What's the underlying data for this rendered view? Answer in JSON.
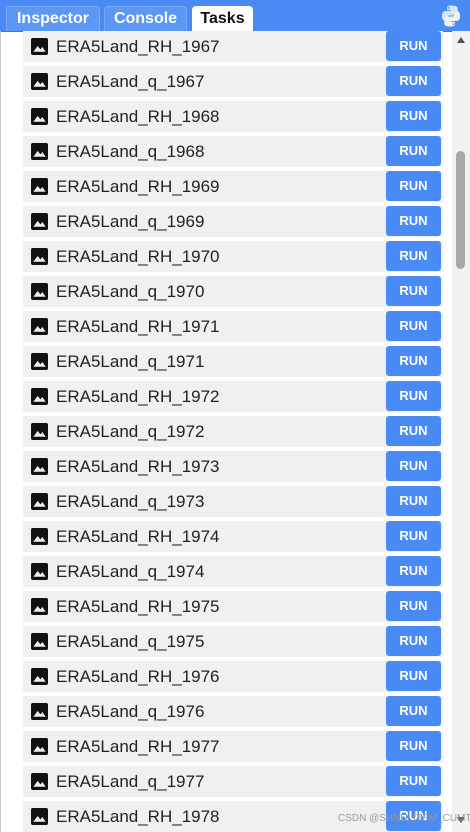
{
  "tabs": {
    "inspector": "Inspector",
    "console": "Console",
    "tasks": "Tasks",
    "active": "Tasks"
  },
  "header": {
    "icon": "python-icon"
  },
  "colors": {
    "accent": "#4a8af4",
    "run_button": "#4a8af4",
    "row_background": "#f0f0f0"
  },
  "tasks": [
    {
      "name": "ERA5Land_RH_1967",
      "icon": "image-icon",
      "action": "RUN"
    },
    {
      "name": "ERA5Land_q_1967",
      "icon": "image-icon",
      "action": "RUN"
    },
    {
      "name": "ERA5Land_RH_1968",
      "icon": "image-icon",
      "action": "RUN"
    },
    {
      "name": "ERA5Land_q_1968",
      "icon": "image-icon",
      "action": "RUN"
    },
    {
      "name": "ERA5Land_RH_1969",
      "icon": "image-icon",
      "action": "RUN"
    },
    {
      "name": "ERA5Land_q_1969",
      "icon": "image-icon",
      "action": "RUN"
    },
    {
      "name": "ERA5Land_RH_1970",
      "icon": "image-icon",
      "action": "RUN"
    },
    {
      "name": "ERA5Land_q_1970",
      "icon": "image-icon",
      "action": "RUN"
    },
    {
      "name": "ERA5Land_RH_1971",
      "icon": "image-icon",
      "action": "RUN"
    },
    {
      "name": "ERA5Land_q_1971",
      "icon": "image-icon",
      "action": "RUN"
    },
    {
      "name": "ERA5Land_RH_1972",
      "icon": "image-icon",
      "action": "RUN"
    },
    {
      "name": "ERA5Land_q_1972",
      "icon": "image-icon",
      "action": "RUN"
    },
    {
      "name": "ERA5Land_RH_1973",
      "icon": "image-icon",
      "action": "RUN"
    },
    {
      "name": "ERA5Land_q_1973",
      "icon": "image-icon",
      "action": "RUN"
    },
    {
      "name": "ERA5Land_RH_1974",
      "icon": "image-icon",
      "action": "RUN"
    },
    {
      "name": "ERA5Land_q_1974",
      "icon": "image-icon",
      "action": "RUN"
    },
    {
      "name": "ERA5Land_RH_1975",
      "icon": "image-icon",
      "action": "RUN"
    },
    {
      "name": "ERA5Land_q_1975",
      "icon": "image-icon",
      "action": "RUN"
    },
    {
      "name": "ERA5Land_RH_1976",
      "icon": "image-icon",
      "action": "RUN"
    },
    {
      "name": "ERA5Land_q_1976",
      "icon": "image-icon",
      "action": "RUN"
    },
    {
      "name": "ERA5Land_RH_1977",
      "icon": "image-icon",
      "action": "RUN"
    },
    {
      "name": "ERA5Land_q_1977",
      "icon": "image-icon",
      "action": "RUN"
    },
    {
      "name": "ERA5Land_RH_1978",
      "icon": "image-icon",
      "action": "RUN"
    }
  ],
  "watermark": "CSDN @SHNU_ITEM_CUMT"
}
